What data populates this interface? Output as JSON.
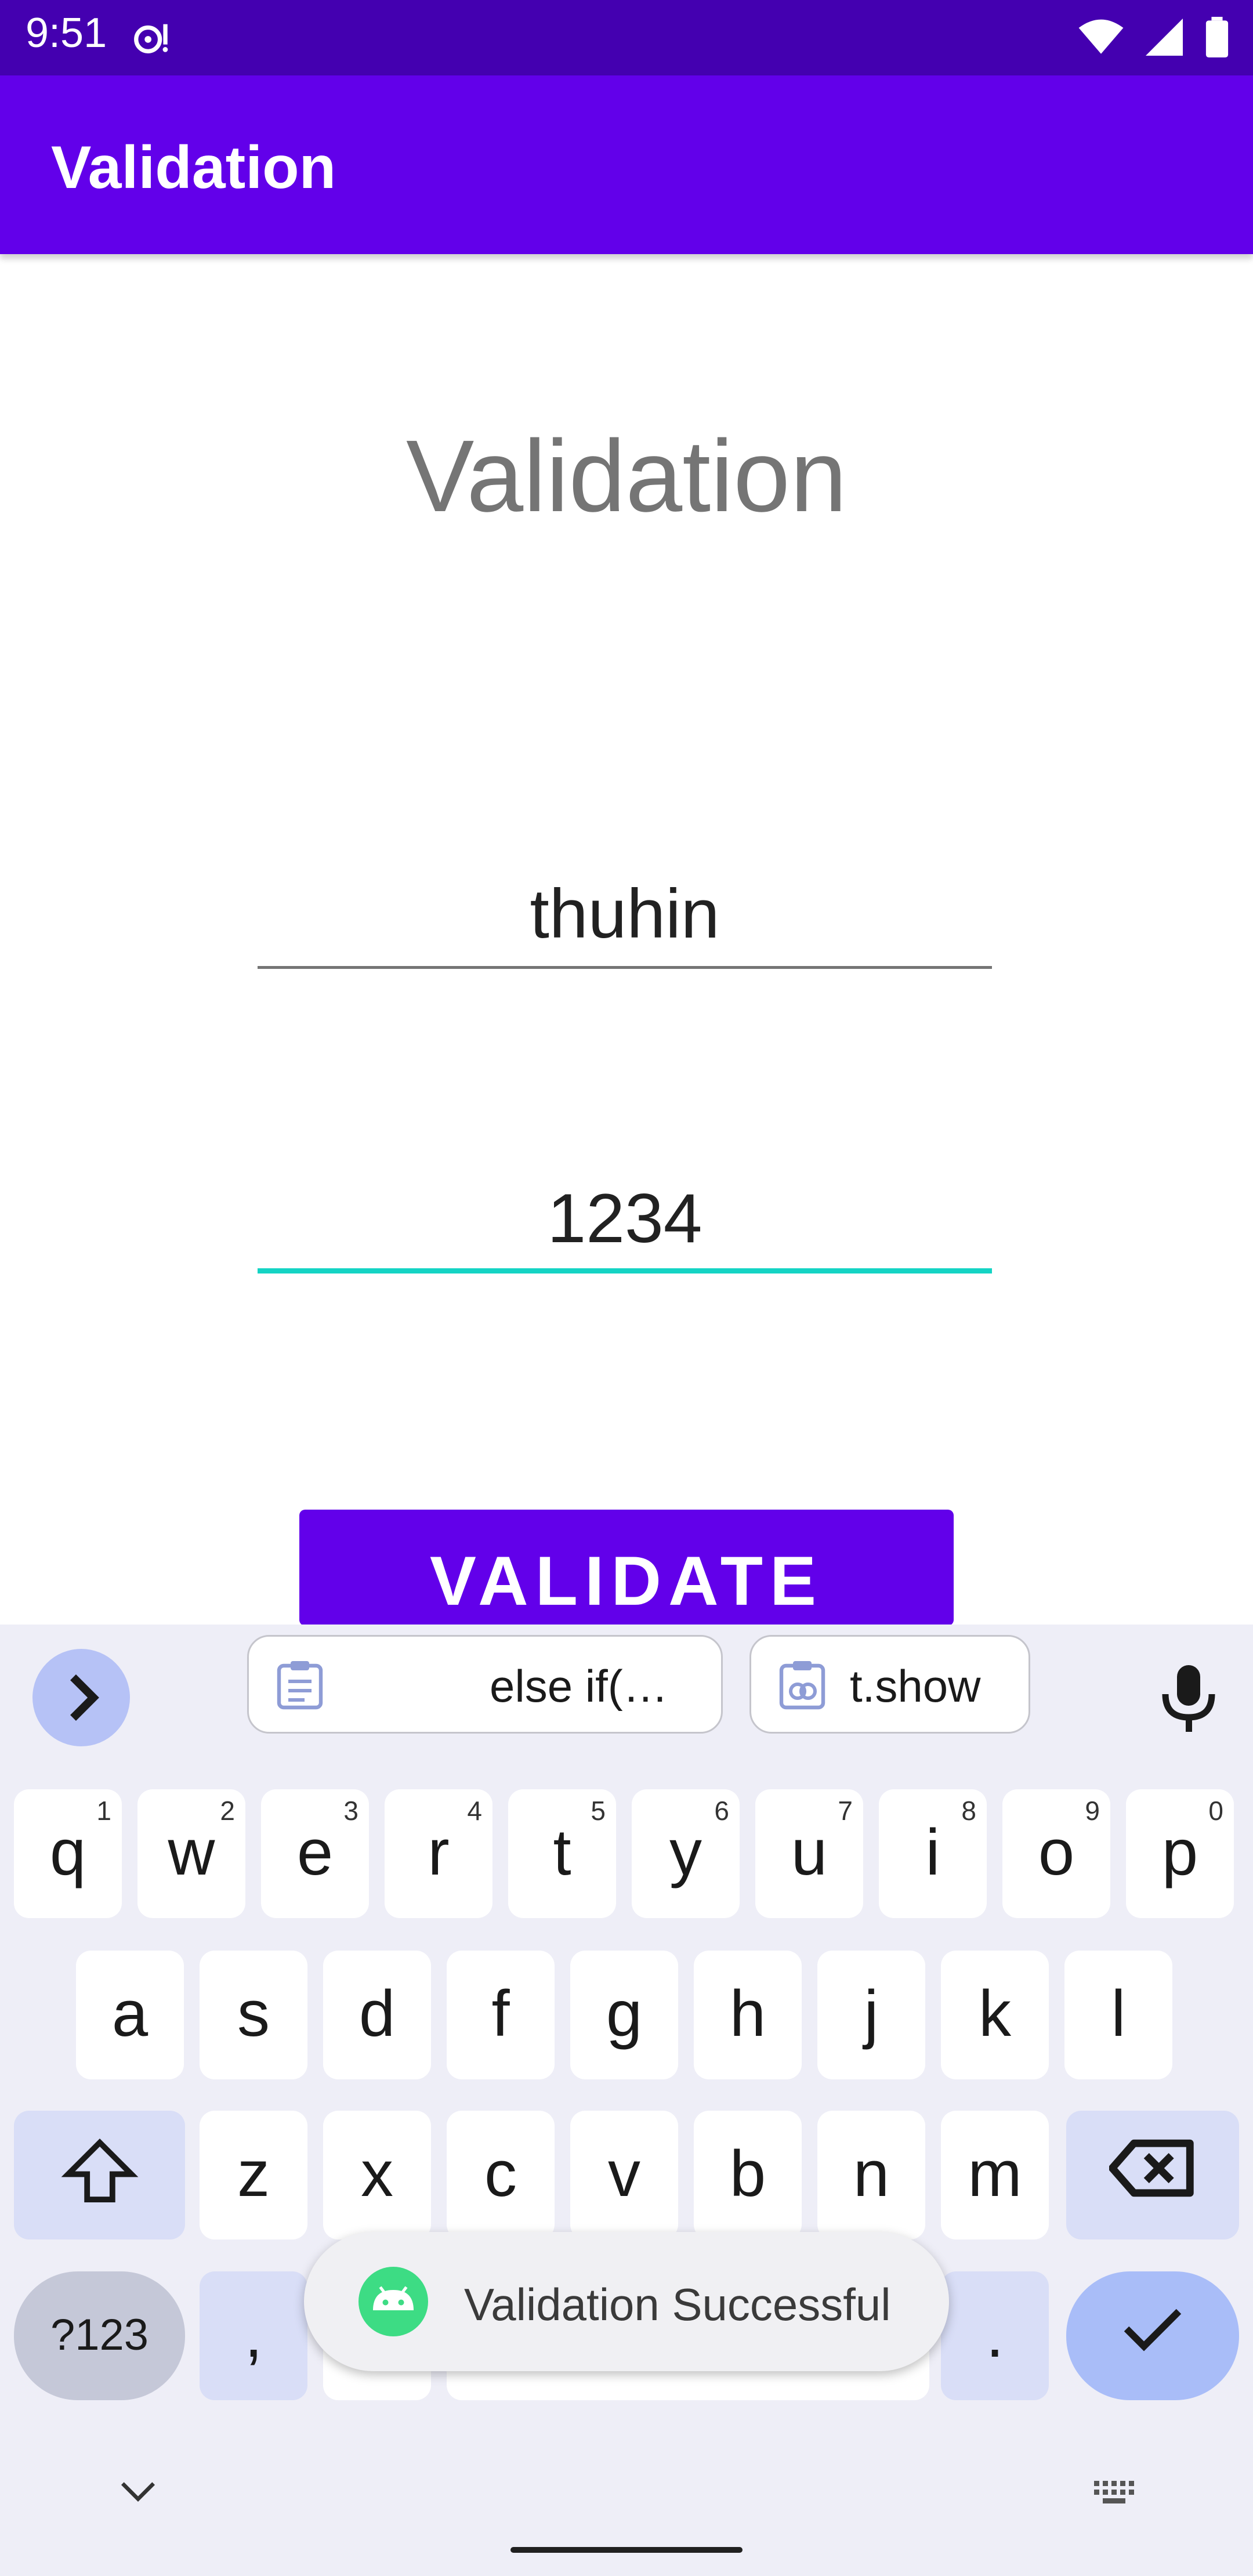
{
  "status_bar": {
    "time": "9:51"
  },
  "app_bar": {
    "title": "Validation"
  },
  "main": {
    "heading": "Validation",
    "username_value": "thuhin",
    "password_value": "1234",
    "validate_label": "VALIDATE"
  },
  "keyboard": {
    "suggestions": [
      "else if(…",
      "t.show"
    ],
    "row1": [
      {
        "k": "q",
        "s": "1"
      },
      {
        "k": "w",
        "s": "2"
      },
      {
        "k": "e",
        "s": "3"
      },
      {
        "k": "r",
        "s": "4"
      },
      {
        "k": "t",
        "s": "5"
      },
      {
        "k": "y",
        "s": "6"
      },
      {
        "k": "u",
        "s": "7"
      },
      {
        "k": "i",
        "s": "8"
      },
      {
        "k": "o",
        "s": "9"
      },
      {
        "k": "p",
        "s": "0"
      }
    ],
    "row2": [
      "a",
      "s",
      "d",
      "f",
      "g",
      "h",
      "j",
      "k",
      "l"
    ],
    "row3": [
      "z",
      "x",
      "c",
      "v",
      "b",
      "n",
      "m"
    ],
    "symbols_label": "?123",
    "comma_label": ",",
    "period_label": "."
  },
  "toast": {
    "message": "Validation Successful"
  },
  "colors": {
    "status_bar": "#4400b0",
    "primary": "#6200ea",
    "accent": "#14d4c4",
    "keyboard_bg": "#eeeef7"
  }
}
